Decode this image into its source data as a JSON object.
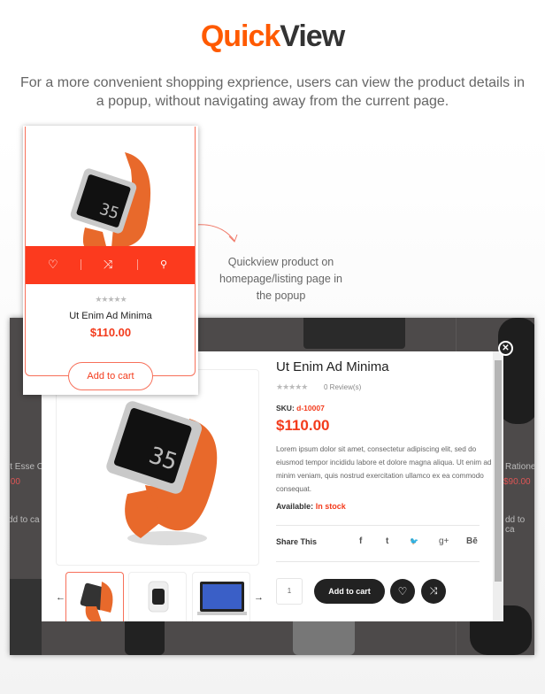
{
  "header": {
    "title_accent": "Quick",
    "title_rest": "View",
    "subtitle": "For a more convenient shopping exprience, users can view the product details in a popup, without navigating away from the current page."
  },
  "annotation": "Quickview product on homepage/listing page in the popup",
  "card": {
    "stars": "★★★★★",
    "title": "Ut Enim Ad Minima",
    "price": "$110.00",
    "add_to_cart": "Add to cart",
    "actions": [
      "heart-icon",
      "shuffle-icon",
      "search-icon"
    ]
  },
  "background": {
    "left_title": "it Esse C",
    "left_price": ".00",
    "left_old": "$7",
    "left_cart": "dd to ca",
    "right_title": "Ratione",
    "right_price": "$90.00",
    "right_cart": "dd to ca"
  },
  "modal": {
    "title": "Ut Enim Ad Minima",
    "stars": "★★★★★",
    "reviews": "0 Review(s)",
    "sku_label": "SKU:",
    "sku": "d-10007",
    "price": "$110.00",
    "description": "Lorem ipsum dolor sit amet, consectetur adipiscing elit, sed do eiusmod tempor incididu labore et dolore magna aliqua. Ut enim ad minim veniam, quis nostrud exercitation ullamco ex ea commodo consequat.",
    "available_label": "Available:",
    "available": "In stock",
    "share_label": "Share This",
    "share": [
      "f",
      "t",
      "🐦",
      "g+",
      "Bē"
    ],
    "qty": "1",
    "add_to_cart": "Add to cart",
    "close": "✕",
    "prev": "←",
    "next": "→"
  },
  "colors": {
    "accent": "#fc3a1e",
    "title_orange": "#ff5a00",
    "dark": "#222222"
  }
}
